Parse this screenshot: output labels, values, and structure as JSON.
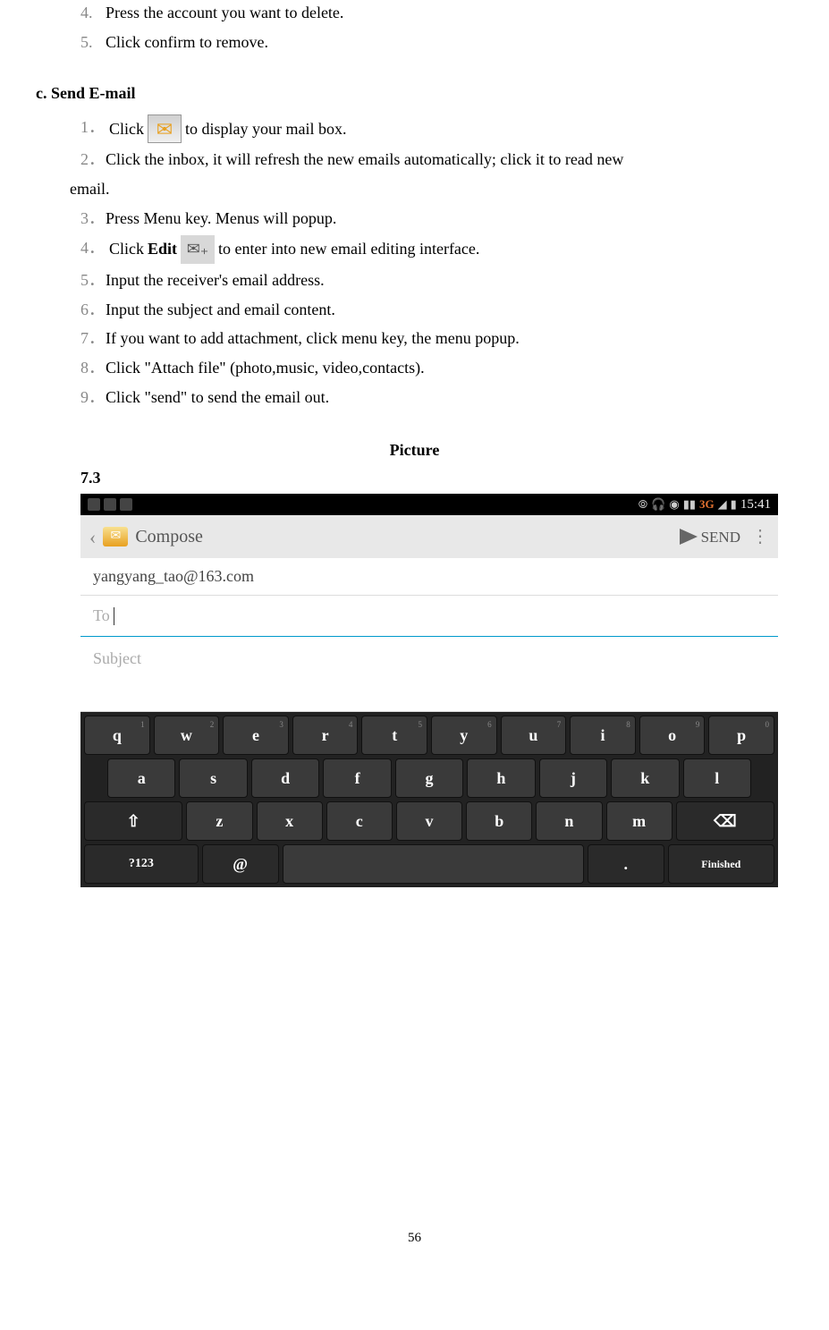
{
  "continued": {
    "item4": {
      "num": "4.",
      "text": "Press the account you want to delete."
    },
    "item5": {
      "num": "5.",
      "text": "Click confirm to remove."
    }
  },
  "section_c": {
    "header": "c.  Send E-mail",
    "steps": {
      "s1": {
        "num": "1．",
        "pre": "Click ",
        "post": " to display your mail box."
      },
      "s2": {
        "num": "2．",
        "line1": "Click the inbox, it will refresh the new emails automatically; click it to read new",
        "line2": "email."
      },
      "s3": {
        "num": "3．",
        "text": "Press Menu key. Menus will popup."
      },
      "s4": {
        "num": "4．",
        "pre": "Click ",
        "bold": "Edit",
        "post": " to enter into new email editing interface."
      },
      "s5": {
        "num": "5．",
        "text": "Input the receiver's email address."
      },
      "s6": {
        "num": "6．",
        "text": "Input the subject and email content."
      },
      "s7": {
        "num": "7．",
        "text": "If you want to add attachment, click menu key, the menu popup."
      },
      "s8": {
        "num": "8．",
        "text": "Click \"Attach file\" (photo,music, video,contacts)."
      },
      "s9": {
        "num": "9．",
        "text": "Click \"send\" to send the email out."
      }
    }
  },
  "picture": {
    "label": "Picture",
    "num": "7.3"
  },
  "phone_ui": {
    "status": {
      "time": "15:41",
      "network": "3G"
    },
    "compose": {
      "title": "Compose",
      "send": "SEND",
      "from": "yangyang_tao@163.com",
      "to_label": "To",
      "subject_placeholder": "Subject"
    },
    "keyboard": {
      "row1": [
        {
          "k": "q",
          "s": "1"
        },
        {
          "k": "w",
          "s": "2"
        },
        {
          "k": "e",
          "s": "3"
        },
        {
          "k": "r",
          "s": "4"
        },
        {
          "k": "t",
          "s": "5"
        },
        {
          "k": "y",
          "s": "6"
        },
        {
          "k": "u",
          "s": "7"
        },
        {
          "k": "i",
          "s": "8"
        },
        {
          "k": "o",
          "s": "9"
        },
        {
          "k": "p",
          "s": "0"
        }
      ],
      "row2": [
        {
          "k": "a"
        },
        {
          "k": "s"
        },
        {
          "k": "d"
        },
        {
          "k": "f"
        },
        {
          "k": "g"
        },
        {
          "k": "h"
        },
        {
          "k": "j"
        },
        {
          "k": "k"
        },
        {
          "k": "l"
        }
      ],
      "row3_shift": "⇧",
      "row3": [
        {
          "k": "z"
        },
        {
          "k": "x"
        },
        {
          "k": "c"
        },
        {
          "k": "v"
        },
        {
          "k": "b"
        },
        {
          "k": "n"
        },
        {
          "k": "m"
        }
      ],
      "row3_back": "⌫",
      "row4": {
        "sym": "?123",
        "at": "@",
        "dot": ".",
        "finished": "Finished"
      }
    }
  },
  "page_number": "56"
}
